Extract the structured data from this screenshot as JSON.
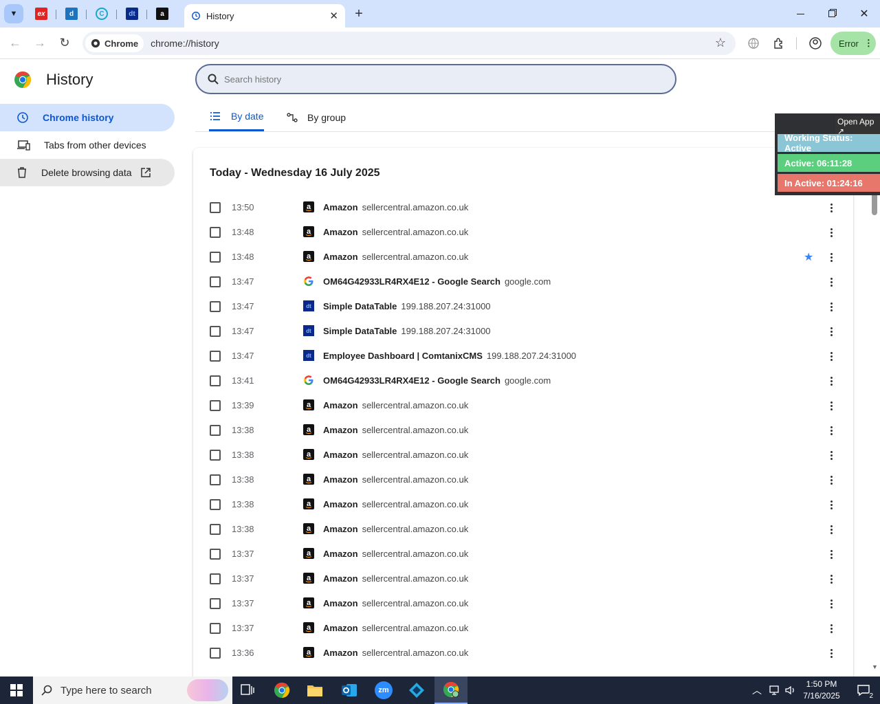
{
  "browser": {
    "active_tab": {
      "title": "History"
    },
    "omnibox": {
      "chip": "Chrome",
      "url": "chrome://history"
    },
    "profile_error": "Error",
    "colors": {
      "tabstrip": "#d3e3fd",
      "accent": "#0b57d0"
    }
  },
  "sidebar": {
    "title": "History",
    "items": [
      {
        "label": "Chrome history",
        "icon": "history-icon",
        "selected": true
      },
      {
        "label": "Tabs from other devices",
        "icon": "devices-icon"
      },
      {
        "label": "Delete browsing data",
        "icon": "trash-icon",
        "trailing_icon": "open-in-new-icon"
      }
    ]
  },
  "search": {
    "placeholder": "Search history"
  },
  "view_tabs": [
    {
      "label": "By date",
      "selected": true
    },
    {
      "label": "By group"
    }
  ],
  "day_header": "Today - Wednesday 16 July 2025",
  "history": [
    {
      "time": "13:50",
      "title": "Amazon",
      "domain": "sellercentral.amazon.co.uk",
      "fav": "amazon"
    },
    {
      "time": "13:48",
      "title": "Amazon",
      "domain": "sellercentral.amazon.co.uk",
      "fav": "amazon"
    },
    {
      "time": "13:48",
      "title": "Amazon",
      "domain": "sellercentral.amazon.co.uk",
      "fav": "amazon",
      "starred": true
    },
    {
      "time": "13:47",
      "title": "OM64G42933LR4RX4E12 - Google Search",
      "domain": "google.com",
      "fav": "google"
    },
    {
      "time": "13:47",
      "title": "Simple DataTable",
      "domain": "199.188.207.24:31000",
      "fav": "dt"
    },
    {
      "time": "13:47",
      "title": "Simple DataTable",
      "domain": "199.188.207.24:31000",
      "fav": "dt"
    },
    {
      "time": "13:47",
      "title": "Employee Dashboard | ComtanixCMS",
      "domain": "199.188.207.24:31000",
      "fav": "dt"
    },
    {
      "time": "13:41",
      "title": "OM64G42933LR4RX4E12 - Google Search",
      "domain": "google.com",
      "fav": "google"
    },
    {
      "time": "13:39",
      "title": "Amazon",
      "domain": "sellercentral.amazon.co.uk",
      "fav": "amazon"
    },
    {
      "time": "13:38",
      "title": "Amazon",
      "domain": "sellercentral.amazon.co.uk",
      "fav": "amazon"
    },
    {
      "time": "13:38",
      "title": "Amazon",
      "domain": "sellercentral.amazon.co.uk",
      "fav": "amazon"
    },
    {
      "time": "13:38",
      "title": "Amazon",
      "domain": "sellercentral.amazon.co.uk",
      "fav": "amazon"
    },
    {
      "time": "13:38",
      "title": "Amazon",
      "domain": "sellercentral.amazon.co.uk",
      "fav": "amazon"
    },
    {
      "time": "13:38",
      "title": "Amazon",
      "domain": "sellercentral.amazon.co.uk",
      "fav": "amazon"
    },
    {
      "time": "13:37",
      "title": "Amazon",
      "domain": "sellercentral.amazon.co.uk",
      "fav": "amazon"
    },
    {
      "time": "13:37",
      "title": "Amazon",
      "domain": "sellercentral.amazon.co.uk",
      "fav": "amazon"
    },
    {
      "time": "13:37",
      "title": "Amazon",
      "domain": "sellercentral.amazon.co.uk",
      "fav": "amazon"
    },
    {
      "time": "13:37",
      "title": "Amazon",
      "domain": "sellercentral.amazon.co.uk",
      "fav": "amazon"
    },
    {
      "time": "13:36",
      "title": "Amazon",
      "domain": "sellercentral.amazon.co.uk",
      "fav": "amazon"
    }
  ],
  "overlay": {
    "open_app": "Open App ↗",
    "working_status": "Working Status: Active",
    "active": "Active: 06:11:28",
    "inactive": "In Active: 01:24:16",
    "colors": {
      "status": "#8ac6d6",
      "active": "#5ccf7e",
      "inactive": "#e8776b"
    }
  },
  "taskbar": {
    "search_placeholder": "Type here to search",
    "time": "1:50 PM",
    "date": "7/16/2025",
    "notifications": "2"
  }
}
